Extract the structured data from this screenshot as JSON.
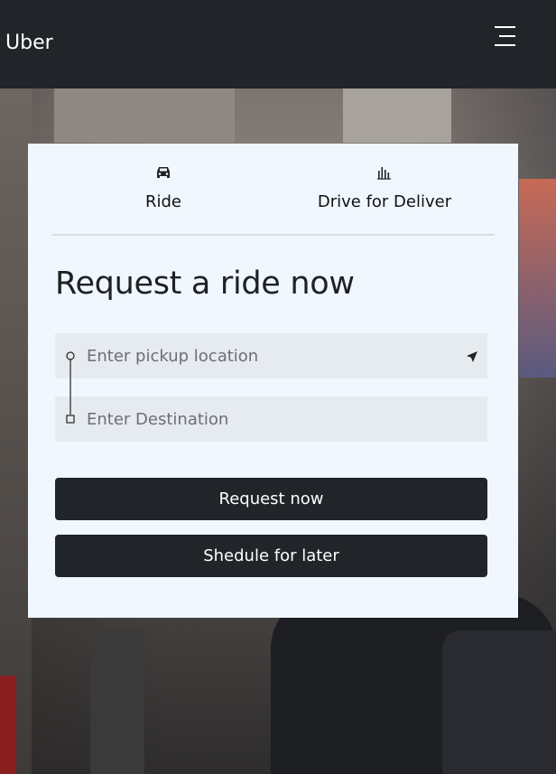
{
  "navbar": {
    "brand": "Uber",
    "menu_icon": "hamburger-menu-icon"
  },
  "tabs": [
    {
      "label": "Ride",
      "icon": "car-icon"
    },
    {
      "label": "Drive for Deliver",
      "icon": "bar-chart-icon"
    }
  ],
  "form": {
    "title": "Request a ride now",
    "pickup": {
      "placeholder": "Enter pickup location",
      "value": "",
      "icon": "navigation-arrow-icon"
    },
    "destination": {
      "placeholder": "Enter Destination",
      "value": ""
    },
    "request_label": "Request now",
    "schedule_label": "Shedule for later"
  },
  "colors": {
    "navbar": "#212429",
    "card": "#f0f7ff",
    "input": "#e6ebf0",
    "button": "#212429"
  }
}
